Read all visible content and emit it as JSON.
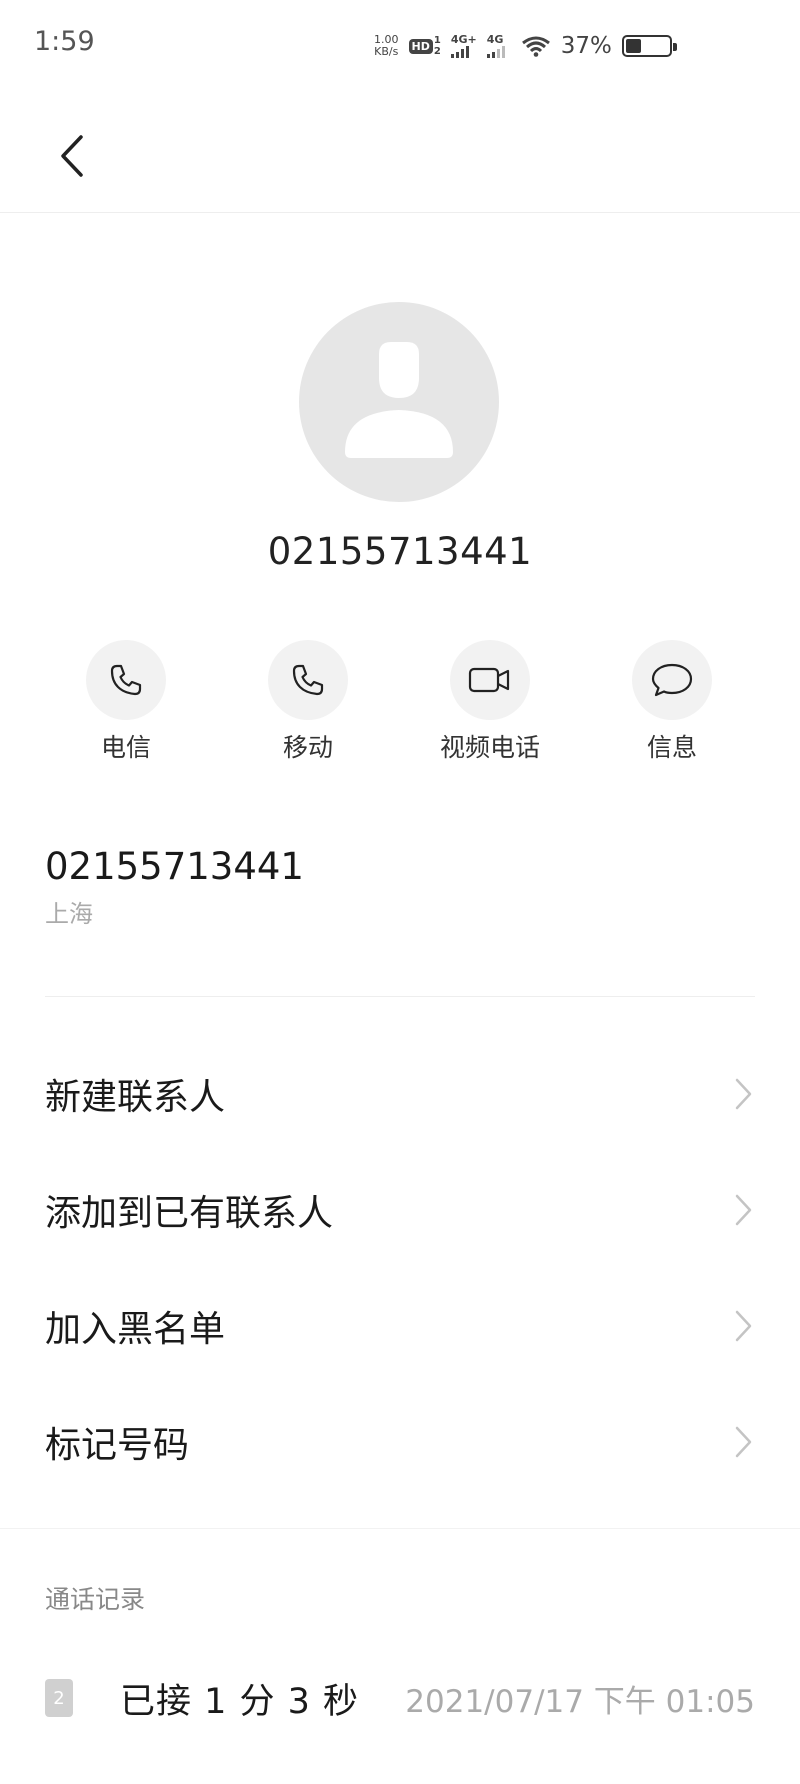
{
  "status_bar": {
    "time": "1:59",
    "net_speed_value": "1.00",
    "net_speed_unit": "KB/s",
    "hd_label": "HD",
    "hd_sim_top": "1",
    "hd_sim_bottom": "2",
    "signal1_label": "4G+",
    "signal2_label": "4G",
    "battery_percent": "37%",
    "battery_level": 0.37
  },
  "contact": {
    "number": "02155713441",
    "location": "上海"
  },
  "actions": [
    {
      "label": "电信",
      "icon": "phone-icon"
    },
    {
      "label": "移动",
      "icon": "phone-icon"
    },
    {
      "label": "视频电话",
      "icon": "video-camera-icon"
    },
    {
      "label": "信息",
      "icon": "message-bubble-icon"
    }
  ],
  "menu": [
    {
      "label": "新建联系人"
    },
    {
      "label": "添加到已有联系人"
    },
    {
      "label": "加入黑名单"
    },
    {
      "label": "标记号码"
    }
  ],
  "call_log": {
    "header": "通话记录",
    "entries": [
      {
        "sim": "2",
        "status": "已接 1 分 3 秒",
        "time": "2021/07/17 下午 01:05"
      }
    ]
  },
  "colors": {
    "avatar_bg": "#e6e6e6",
    "action_circle_bg": "#f2f2f2",
    "secondary_text": "#aaaaaa"
  }
}
